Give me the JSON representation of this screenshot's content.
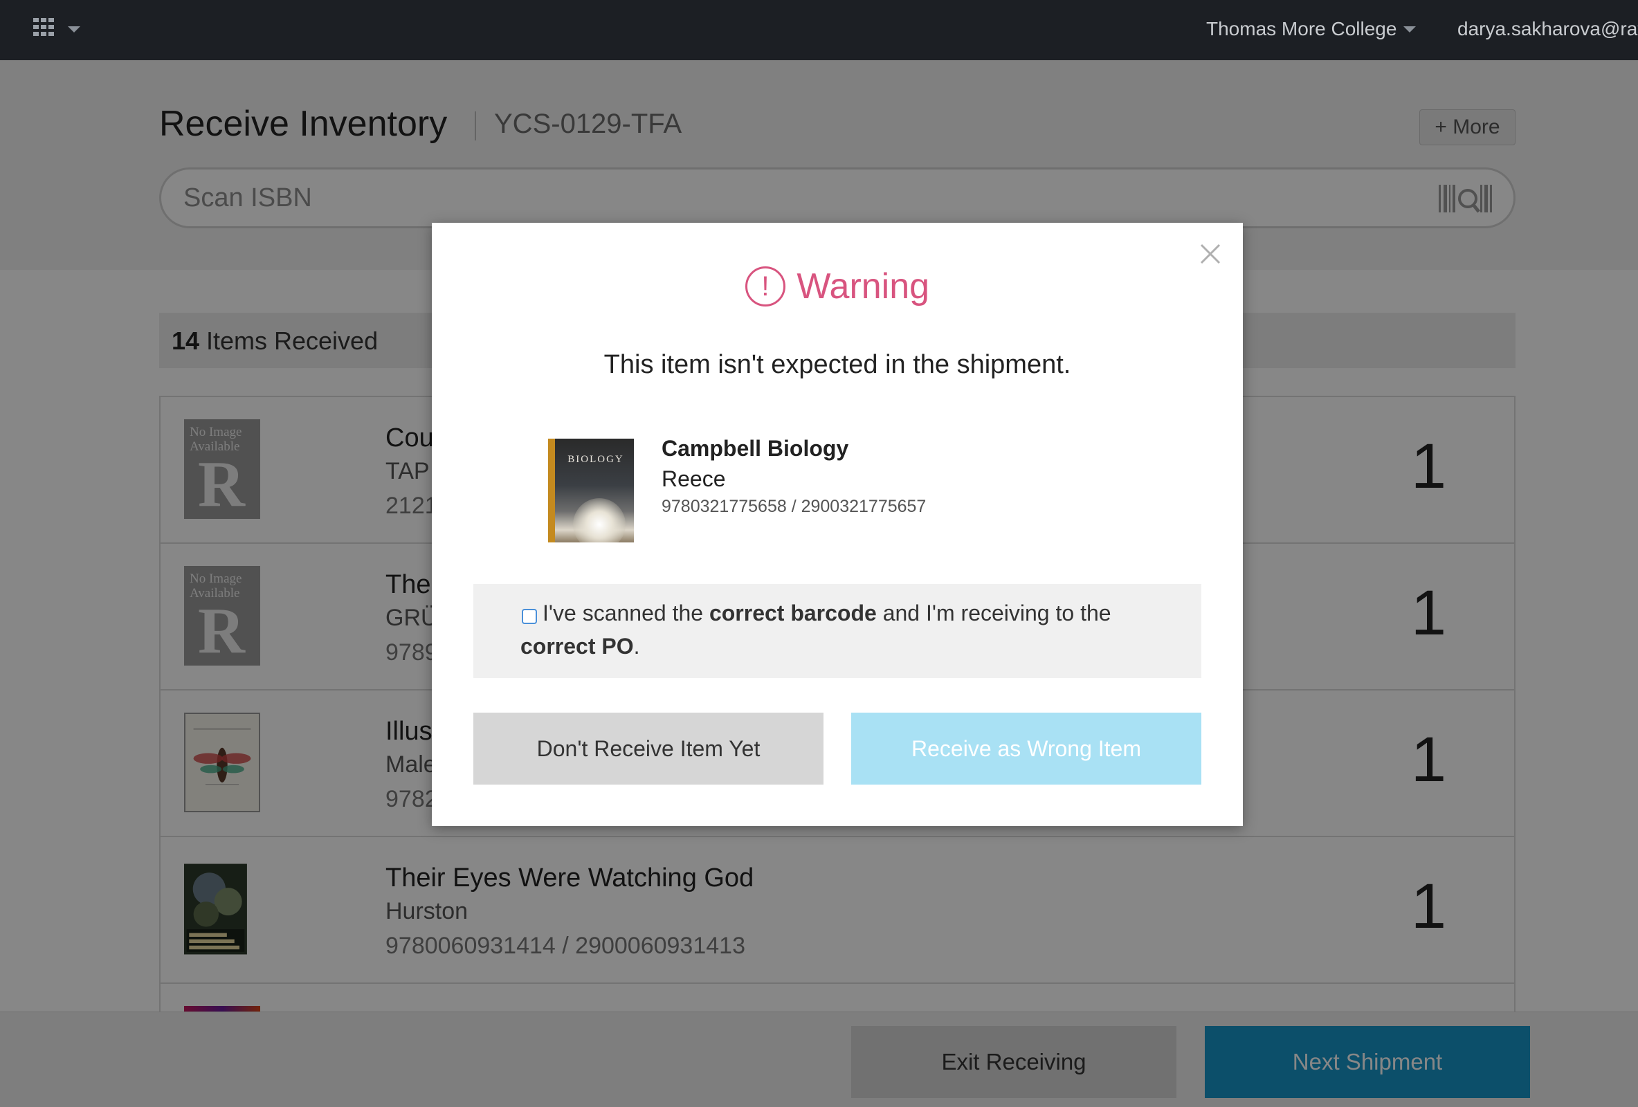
{
  "topbar": {
    "apps_icon": "apps-grid-icon",
    "college": "Thomas More College",
    "user": "darya.sakharova@rafte"
  },
  "header": {
    "title": "Receive Inventory",
    "po_code": "YCS-0129-TFA",
    "more_label": "+ More",
    "scan_placeholder": "Scan ISBN"
  },
  "received": {
    "count": "14",
    "label": "Items Received"
  },
  "items": [
    {
      "title": "Cou",
      "author": "TAP",
      "isbn": "2121",
      "qty": "1",
      "cover": "no-image"
    },
    {
      "title": "The",
      "author": "GRÜ",
      "isbn": "9789",
      "qty": "1",
      "cover": "no-image"
    },
    {
      "title": "Illus",
      "author": "Male",
      "isbn": "9782",
      "qty": "1",
      "cover": "illustration"
    },
    {
      "title": "Their Eyes Were Watching God",
      "author": "Hurston",
      "isbn": "9780060931414 / 2900060931413",
      "qty": "1",
      "cover": "their-eyes"
    }
  ],
  "no_image_text": "No Image Available",
  "no_image_letter": "R",
  "footer": {
    "exit_label": "Exit Receiving",
    "next_label": "Next Shipment"
  },
  "modal": {
    "icon_glyph": "!",
    "title": "Warning",
    "message": "This item isn't expected in the shipment.",
    "item": {
      "cover_title": "BIOLOGY",
      "title": "Campbell Biology",
      "author": "Reece",
      "isbn": "9780321775658 / 2900321775657"
    },
    "confirm": {
      "part1": "I've scanned the ",
      "bold1": "correct barcode",
      "part2": " and I'm receiving to the ",
      "bold2": "correct PO",
      "part3": "."
    },
    "dont_label": "Don't Receive Item Yet",
    "wrong_label": "Receive as Wrong Item"
  },
  "colors": {
    "topbar": "#1c1f24",
    "warning": "#d8547f",
    "primary": "#1895c8",
    "primary_disabled": "#a9e1f4"
  }
}
